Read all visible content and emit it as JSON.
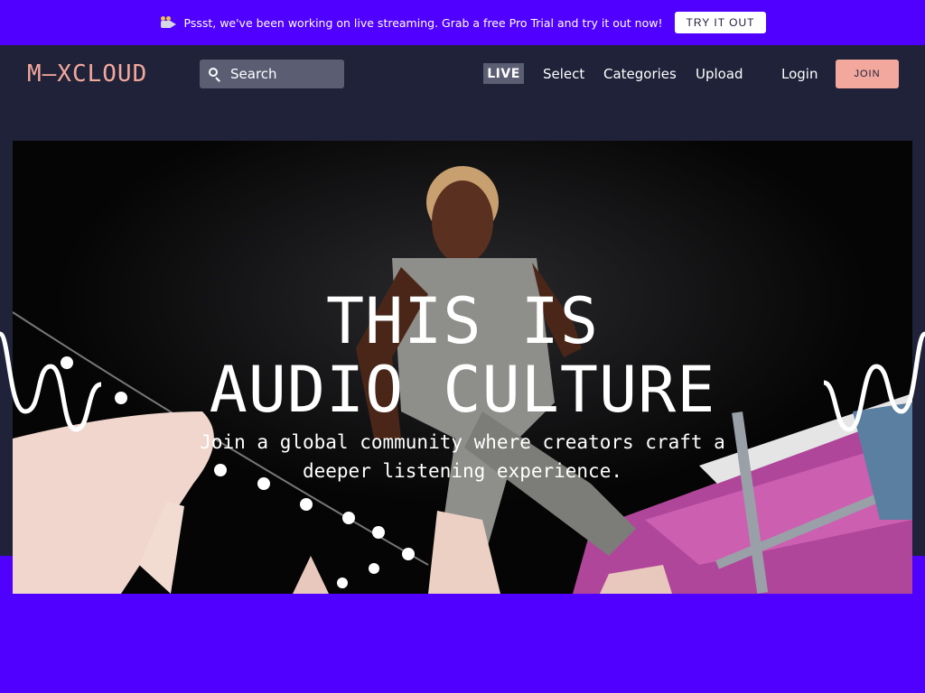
{
  "promo": {
    "icon": "film-camera-icon",
    "text": "Pssst, we've been working on live streaming. Grab a free Pro Trial and try it out now!",
    "button_label": "TRY IT OUT"
  },
  "header": {
    "logo_text": "M—XCLOUD",
    "search": {
      "placeholder": "Search",
      "icon": "search-icon"
    },
    "live_label": "LIVE",
    "nav": {
      "select": "Select",
      "categories": "Categories",
      "upload": "Upload",
      "login": "Login"
    },
    "join_label": "JOIN"
  },
  "hero": {
    "headline_line1": "THIS IS",
    "headline_line2": "AUDIO CULTURE",
    "subhead_line1": "Join a global community where creators craft a",
    "subhead_line2": "deeper listening experience."
  },
  "colors": {
    "brand_purple": "#5000ff",
    "header_bg": "#1f2238",
    "accent_pink": "#f2a89c",
    "search_bg": "#5b5e72"
  }
}
